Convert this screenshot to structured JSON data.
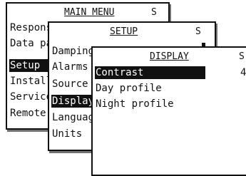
{
  "main_menu": {
    "title": "MAIN MENU",
    "status": "S",
    "items": [
      {
        "label": "Response"
      },
      {
        "label": "Data page"
      },
      {
        "label": "Setup"
      },
      {
        "label": "Installation"
      },
      {
        "label": "Service"
      },
      {
        "label": "Remote"
      }
    ],
    "selected_index": 2
  },
  "setup": {
    "title": "SETUP",
    "status": "S",
    "items": [
      {
        "label": "Damping"
      },
      {
        "label": "Alarms"
      },
      {
        "label": "Source"
      },
      {
        "label": "Display"
      },
      {
        "label": "Language"
      },
      {
        "label": "Units"
      }
    ],
    "selected_index": 3
  },
  "display": {
    "title": "DISPLAY",
    "status": "S",
    "items": [
      {
        "label": "Contrast",
        "value": "4"
      },
      {
        "label": "Day profile"
      },
      {
        "label": "Night profile"
      }
    ],
    "selected_index": 0
  }
}
